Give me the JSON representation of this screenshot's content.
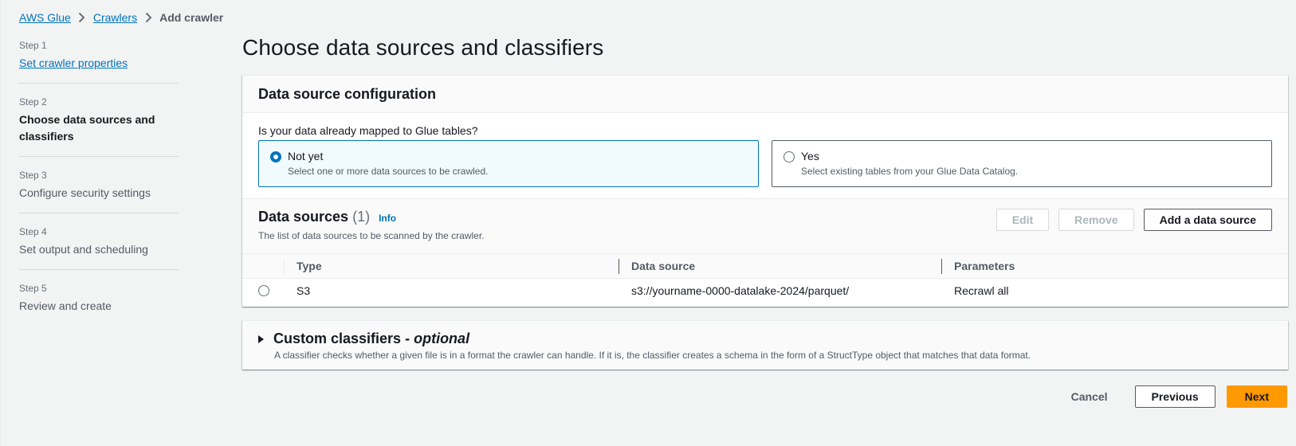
{
  "breadcrumb": [
    {
      "label": "AWS Glue",
      "link": true
    },
    {
      "label": "Crawlers",
      "link": true
    },
    {
      "label": "Add crawler",
      "link": false
    }
  ],
  "steps": [
    {
      "number": "Step 1",
      "title": "Set crawler properties",
      "state": "completed"
    },
    {
      "number": "Step 2",
      "title": "Choose data sources and classifiers",
      "state": "active"
    },
    {
      "number": "Step 3",
      "title": "Configure security settings",
      "state": "upcoming"
    },
    {
      "number": "Step 4",
      "title": "Set output and scheduling",
      "state": "upcoming"
    },
    {
      "number": "Step 5",
      "title": "Review and create",
      "state": "upcoming"
    }
  ],
  "page_title": "Choose data sources and classifiers",
  "data_source_config": {
    "header": "Data source configuration",
    "question": "Is your data already mapped to Glue tables?",
    "options": [
      {
        "label": "Not yet",
        "description": "Select one or more data sources to be crawled.",
        "selected": true
      },
      {
        "label": "Yes",
        "description": "Select existing tables from your Glue Data Catalog.",
        "selected": false
      }
    ]
  },
  "data_sources": {
    "title": "Data sources",
    "count": "(1)",
    "info_label": "Info",
    "description": "The list of data sources to be scanned by the crawler.",
    "buttons": {
      "edit": "Edit",
      "remove": "Remove",
      "add": "Add a data source"
    },
    "columns": [
      "Type",
      "Data source",
      "Parameters"
    ],
    "rows": [
      {
        "type": "S3",
        "data_source": "s3://yourname-0000-datalake-2024/parquet/",
        "parameters": "Recrawl all",
        "selected": false
      }
    ]
  },
  "custom_classifiers": {
    "title": "Custom classifiers - ",
    "title_optional": "optional",
    "description": "A classifier checks whether a given file is in a format the crawler can handle. If it is, the classifier creates a schema in the form of a StructType object that matches that data format.",
    "expanded": false
  },
  "footer": {
    "cancel": "Cancel",
    "previous": "Previous",
    "next": "Next"
  },
  "colors": {
    "accent": "#0073bb",
    "primary_button": "#ff9900",
    "background": "#f2f3f3"
  }
}
